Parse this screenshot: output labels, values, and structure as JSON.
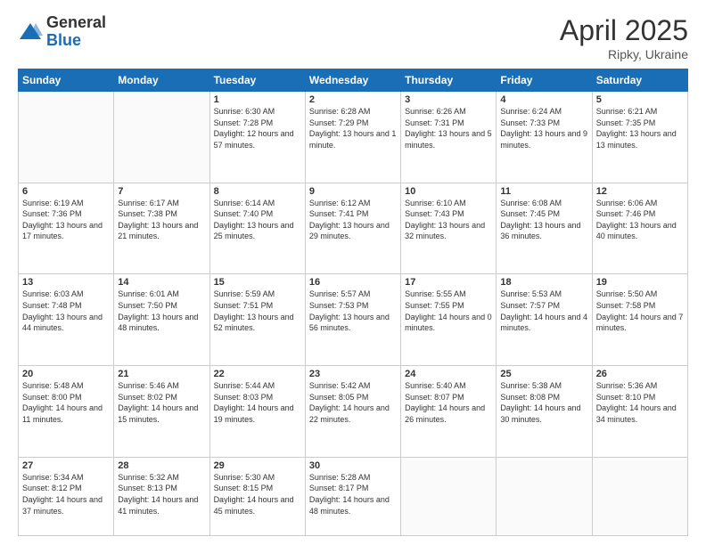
{
  "logo": {
    "general": "General",
    "blue": "Blue"
  },
  "title": "April 2025",
  "subtitle": "Ripky, Ukraine",
  "days_header": [
    "Sunday",
    "Monday",
    "Tuesday",
    "Wednesday",
    "Thursday",
    "Friday",
    "Saturday"
  ],
  "weeks": [
    [
      {
        "num": "",
        "info": ""
      },
      {
        "num": "",
        "info": ""
      },
      {
        "num": "1",
        "info": "Sunrise: 6:30 AM\nSunset: 7:28 PM\nDaylight: 12 hours and 57 minutes."
      },
      {
        "num": "2",
        "info": "Sunrise: 6:28 AM\nSunset: 7:29 PM\nDaylight: 13 hours and 1 minute."
      },
      {
        "num": "3",
        "info": "Sunrise: 6:26 AM\nSunset: 7:31 PM\nDaylight: 13 hours and 5 minutes."
      },
      {
        "num": "4",
        "info": "Sunrise: 6:24 AM\nSunset: 7:33 PM\nDaylight: 13 hours and 9 minutes."
      },
      {
        "num": "5",
        "info": "Sunrise: 6:21 AM\nSunset: 7:35 PM\nDaylight: 13 hours and 13 minutes."
      }
    ],
    [
      {
        "num": "6",
        "info": "Sunrise: 6:19 AM\nSunset: 7:36 PM\nDaylight: 13 hours and 17 minutes."
      },
      {
        "num": "7",
        "info": "Sunrise: 6:17 AM\nSunset: 7:38 PM\nDaylight: 13 hours and 21 minutes."
      },
      {
        "num": "8",
        "info": "Sunrise: 6:14 AM\nSunset: 7:40 PM\nDaylight: 13 hours and 25 minutes."
      },
      {
        "num": "9",
        "info": "Sunrise: 6:12 AM\nSunset: 7:41 PM\nDaylight: 13 hours and 29 minutes."
      },
      {
        "num": "10",
        "info": "Sunrise: 6:10 AM\nSunset: 7:43 PM\nDaylight: 13 hours and 32 minutes."
      },
      {
        "num": "11",
        "info": "Sunrise: 6:08 AM\nSunset: 7:45 PM\nDaylight: 13 hours and 36 minutes."
      },
      {
        "num": "12",
        "info": "Sunrise: 6:06 AM\nSunset: 7:46 PM\nDaylight: 13 hours and 40 minutes."
      }
    ],
    [
      {
        "num": "13",
        "info": "Sunrise: 6:03 AM\nSunset: 7:48 PM\nDaylight: 13 hours and 44 minutes."
      },
      {
        "num": "14",
        "info": "Sunrise: 6:01 AM\nSunset: 7:50 PM\nDaylight: 13 hours and 48 minutes."
      },
      {
        "num": "15",
        "info": "Sunrise: 5:59 AM\nSunset: 7:51 PM\nDaylight: 13 hours and 52 minutes."
      },
      {
        "num": "16",
        "info": "Sunrise: 5:57 AM\nSunset: 7:53 PM\nDaylight: 13 hours and 56 minutes."
      },
      {
        "num": "17",
        "info": "Sunrise: 5:55 AM\nSunset: 7:55 PM\nDaylight: 14 hours and 0 minutes."
      },
      {
        "num": "18",
        "info": "Sunrise: 5:53 AM\nSunset: 7:57 PM\nDaylight: 14 hours and 4 minutes."
      },
      {
        "num": "19",
        "info": "Sunrise: 5:50 AM\nSunset: 7:58 PM\nDaylight: 14 hours and 7 minutes."
      }
    ],
    [
      {
        "num": "20",
        "info": "Sunrise: 5:48 AM\nSunset: 8:00 PM\nDaylight: 14 hours and 11 minutes."
      },
      {
        "num": "21",
        "info": "Sunrise: 5:46 AM\nSunset: 8:02 PM\nDaylight: 14 hours and 15 minutes."
      },
      {
        "num": "22",
        "info": "Sunrise: 5:44 AM\nSunset: 8:03 PM\nDaylight: 14 hours and 19 minutes."
      },
      {
        "num": "23",
        "info": "Sunrise: 5:42 AM\nSunset: 8:05 PM\nDaylight: 14 hours and 22 minutes."
      },
      {
        "num": "24",
        "info": "Sunrise: 5:40 AM\nSunset: 8:07 PM\nDaylight: 14 hours and 26 minutes."
      },
      {
        "num": "25",
        "info": "Sunrise: 5:38 AM\nSunset: 8:08 PM\nDaylight: 14 hours and 30 minutes."
      },
      {
        "num": "26",
        "info": "Sunrise: 5:36 AM\nSunset: 8:10 PM\nDaylight: 14 hours and 34 minutes."
      }
    ],
    [
      {
        "num": "27",
        "info": "Sunrise: 5:34 AM\nSunset: 8:12 PM\nDaylight: 14 hours and 37 minutes."
      },
      {
        "num": "28",
        "info": "Sunrise: 5:32 AM\nSunset: 8:13 PM\nDaylight: 14 hours and 41 minutes."
      },
      {
        "num": "29",
        "info": "Sunrise: 5:30 AM\nSunset: 8:15 PM\nDaylight: 14 hours and 45 minutes."
      },
      {
        "num": "30",
        "info": "Sunrise: 5:28 AM\nSunset: 8:17 PM\nDaylight: 14 hours and 48 minutes."
      },
      {
        "num": "",
        "info": ""
      },
      {
        "num": "",
        "info": ""
      },
      {
        "num": "",
        "info": ""
      }
    ]
  ]
}
